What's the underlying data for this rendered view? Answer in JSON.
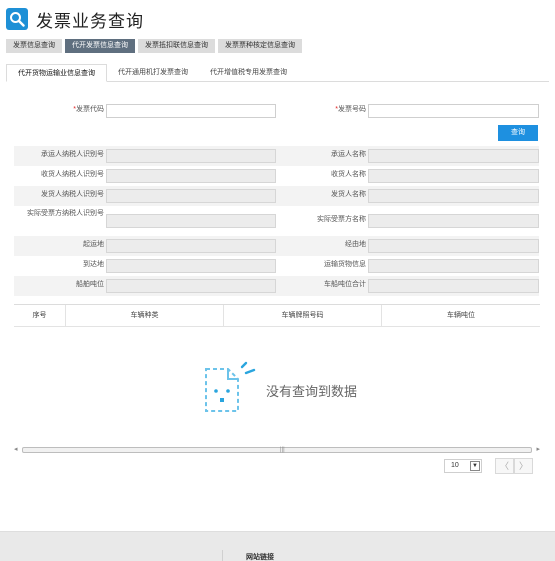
{
  "header": {
    "title": "发票业务查询",
    "icon": "search-icon",
    "accent": "#1e90d6"
  },
  "top_tabs": [
    {
      "label": "发票信息查询",
      "active": false
    },
    {
      "label": "代开发票信息查询",
      "active": true
    },
    {
      "label": "发票抵扣联信息查询",
      "active": false
    },
    {
      "label": "发票票种核定信息查询",
      "active": false
    }
  ],
  "sub_tabs": [
    {
      "label": "代开货物运输业信息查询",
      "active": true
    },
    {
      "label": "代开通用机打发票查询",
      "active": false
    },
    {
      "label": "代开增值税专用发票查询",
      "active": false
    }
  ],
  "search": {
    "required_mark": "*",
    "invoice_code_label": "发票代码",
    "invoice_code_value": "",
    "invoice_number_label": "发票号码",
    "invoice_number_value": "",
    "query_button": "查询"
  },
  "fields": {
    "carrier_taxid": "承运人纳税人识别号",
    "carrier_name": "承运人名称",
    "receiver_taxid": "收货人纳税人识别号",
    "receiver_name": "收货人名称",
    "shipper_taxid": "发货人纳税人识别号",
    "shipper_name": "发货人名称",
    "recipient_taxid": "实际受票方纳税人识别号",
    "recipient_name": "实际受票方名称",
    "origin": "起运地",
    "via": "经由地",
    "destination": "到达地",
    "cargo_info": "运输货物信息",
    "vessel_tonnage": "船舶吨位",
    "vehicle_tonnage_total": "车船吨位合计"
  },
  "table": {
    "columns": [
      "序号",
      "车辆种类",
      "车辆牌照号码",
      "车辆吨位"
    ],
    "empty_text": "没有查询到数据",
    "scroll_grip": "|||"
  },
  "pager": {
    "page_size": "10",
    "prev": "〈",
    "next": "〉",
    "caret": "▼"
  },
  "footer": {
    "label": "网站链接"
  }
}
